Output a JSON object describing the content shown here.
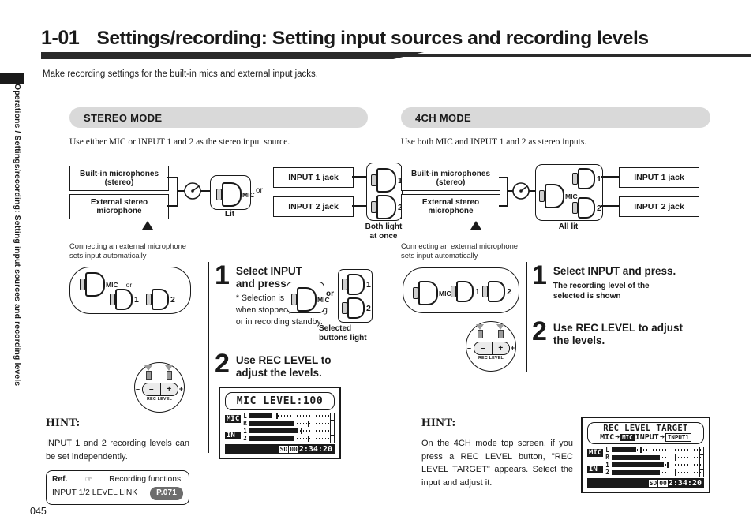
{
  "sidebar": {
    "vertical_label": "Operations / Settings/recording: Setting input sources and recording levels"
  },
  "header": {
    "section_number": "1-01",
    "title": "Settings/recording: Setting input sources and recording levels",
    "lede": "Make recording settings for the built-in mics and external input jacks."
  },
  "page_number": "045",
  "left_column": {
    "mode_title": "STEREO MODE",
    "mode_sub": "Use either MIC or INPUT 1 and 2 as the stereo input source.",
    "diagram": {
      "source_box_1": "Built-in microphones (stereo)",
      "source_box_1_l1": "Built-in microphones",
      "source_box_1_l2": "(stereo)",
      "source_box_2_l1": "External stereo",
      "source_box_2_l2": "microphone",
      "mic_button_label": "MIC",
      "mic_caption": "Lit",
      "or_label": "or",
      "jack_1": "INPUT 1 jack",
      "jack_2": "INPUT 2 jack",
      "btn_1": "1",
      "btn_2": "2",
      "jack_caption_l1": "Both light",
      "jack_caption_l2": "at once",
      "note_l1": "Connecting an external microphone",
      "note_l2": "sets input automatically"
    },
    "panel": {
      "mic_label": "MIC",
      "or_label": "or",
      "btn_1": "1",
      "btn_2": "2"
    },
    "step1": {
      "number": "1",
      "title_l1": "Select INPUT",
      "title_l2": "and press.",
      "note": "* Selection is possible when stopped, recording or in recording standby.",
      "mic_label": "MIC",
      "or_label": "or",
      "btn_1": "1",
      "btn_2": "2",
      "caption_l1": "Selected",
      "caption_l2": "buttons light"
    },
    "step2": {
      "number": "2",
      "title_l1": "Use REC LEVEL to",
      "title_l2": "adjust the levels."
    },
    "knob": {
      "minus_outer": "–",
      "plus_outer": "+",
      "minus": "–",
      "plus": "+",
      "label": "REC LEVEL"
    },
    "hint": {
      "heading": "HINT:",
      "body": "INPUT 1 and 2 recording levels can be set independently.",
      "ref_label": "Ref.",
      "ref_text": "Recording     functions:",
      "ref_item": "INPUT 1/2 LEVEL LINK",
      "ref_page": "P.071"
    },
    "lcd": {
      "title": "MIC LEVEL:100",
      "tag_mic": "MIC",
      "tag_in": "IN",
      "rows": [
        {
          "ch": "L",
          "fill": 26,
          "tick": 31
        },
        {
          "ch": "R",
          "fill": 52,
          "tick": 68
        },
        {
          "ch": "1",
          "fill": 56,
          "tick": 60
        },
        {
          "ch": "2",
          "fill": 52,
          "tick": 68
        }
      ],
      "status_card": "SD",
      "status_count": "00",
      "status_time": "2:34:20"
    }
  },
  "right_column": {
    "mode_title": "4CH MODE",
    "mode_sub": "Use both MIC and INPUT 1 and 2 as stereo inputs.",
    "diagram": {
      "source_box_1_l1": "Built-in microphones",
      "source_box_1_l2": "(stereo)",
      "source_box_2_l1": "External stereo",
      "source_box_2_l2": "microphone",
      "mic_button_label": "MIC",
      "btn_1": "1",
      "btn_2": "2",
      "jack_1": "INPUT 1 jack",
      "jack_2": "INPUT 2 jack",
      "caption": "All lit",
      "note_l1": "Connecting an external microphone",
      "note_l2": "sets input automatically"
    },
    "panel": {
      "mic_label": "MIC",
      "btn_1": "1",
      "btn_2": "2"
    },
    "step1": {
      "number": "1",
      "title": "Select INPUT and press.",
      "note_l1": "The recording level of the",
      "note_l2": "selected is shown"
    },
    "step2": {
      "number": "2",
      "title_l1": "Use REC LEVEL to adjust",
      "title_l2": "the levels."
    },
    "knob": {
      "minus_outer": "–",
      "plus_outer": "+",
      "minus": "–",
      "plus": "+",
      "label": "REC LEVEL"
    },
    "hint": {
      "heading": "HINT:",
      "body": "On the 4CH mode top screen, if you press a REC LEVEL button, \"REC LEVEL TARGET\" appears. Select the input and adjust it."
    },
    "lcd": {
      "title": "REC LEVEL TARGET",
      "line2_a": "MIC",
      "line2_arrow1": "➜",
      "line2_badge1": "MIC",
      "line2_b": "INPUT",
      "line2_arrow2": "➜",
      "line2_badge2": "INPUT1",
      "tag_mic": "MIC",
      "tag_in": "IN",
      "rows": [
        {
          "ch": "L",
          "fill": 26,
          "tick": 31
        },
        {
          "ch": "R",
          "fill": 52,
          "tick": 68
        },
        {
          "ch": "1",
          "fill": 56,
          "tick": 60
        },
        {
          "ch": "2",
          "fill": 52,
          "tick": 68
        }
      ],
      "status_card": "SD",
      "status_count": "00",
      "status_time": "2:34:20"
    }
  }
}
